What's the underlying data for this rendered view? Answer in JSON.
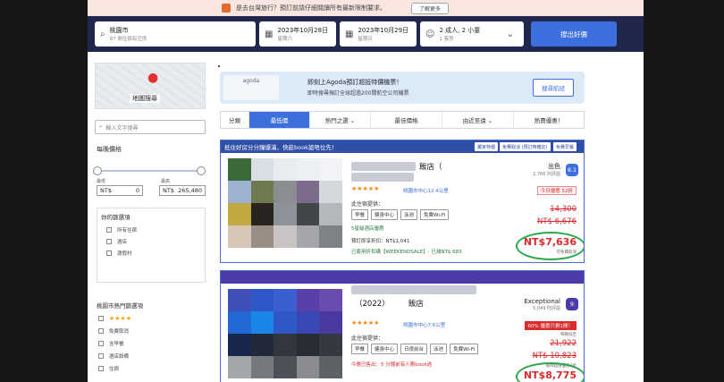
{
  "notice": {
    "text": "是去台灣旅行？預訂前請仔細閱讀所有最新限制要求。",
    "more": "了解更多"
  },
  "search": {
    "destination": "桃園市",
    "destination_sub": "97 間住宿有空房",
    "checkin": "2023年10月28日",
    "checkin_day": "星期六",
    "checkout": "2023年10月29日",
    "checkout_day": "星期日",
    "guests": "2 成人, 2 小童",
    "rooms": "1 客房",
    "button": "搜出好價"
  },
  "sidebar": {
    "map_label": "地圖搜尋",
    "search_placeholder": "輸入文字搜尋",
    "price_title": "每晚價格",
    "min_label": "最低",
    "max_label": "最高",
    "currency": "NT$",
    "min_value": "0",
    "max_value": "265,480",
    "budget_title": "你的篩選項",
    "budget_items": [
      "所有住宿",
      "酒店",
      "渡假村"
    ],
    "popular_title": "桃園市熱門篩選項",
    "popular_items": [
      "★★★★",
      "免費取消",
      "含早餐",
      "酒店設備",
      "住宿"
    ]
  },
  "promo": {
    "logo": "agoda",
    "line1": "即刻上Agoda預訂超抵特價機票！",
    "line2": "即時搜尋預訂全球超過200間航空公司機票",
    "button": "搜尋航班"
  },
  "tabs": [
    "分類",
    "最低價",
    "熱門之選 ⌄",
    "最佳價格",
    "由近至遠 ⌄",
    "熱賣優惠！"
  ],
  "hotels": [
    {
      "header": "抵住好房分分鐘爆滿，快趁book搶唔位先！",
      "tags": [
        "獨家特價",
        "免費取消 (預訂時確定)",
        "免費早餐"
      ],
      "name": "飯店（",
      "stars": "★★★★★",
      "location": "桃園市中心12.4公里",
      "provides": "此住宿提供：",
      "chips": [
        "早餐",
        "健身中心",
        "泳池",
        "免費Wi-Fi"
      ],
      "note1": "5星級酒店優惠",
      "note2": "預訂即享折扣：NT$1,041",
      "note3": "已套用折扣碼【WEEKENDSALE】- 已減NT$ 683",
      "review_word": "出色",
      "review_count": "2,766 則評語",
      "score": "8.1",
      "deal": "今日優惠 52折",
      "old_price_1": "14,300",
      "old_price_2": "NT$ 6,676",
      "price": "NT$7,636",
      "price_sub": "可免費取消"
    },
    {
      "header": "",
      "tags": [],
      "name": "（2022）　　　飯店",
      "stars": "★★★★★",
      "location": "桃園市中心7.6公里",
      "provides": "此住宿提供：",
      "chips": [
        "早餐",
        "健身中心",
        "日夜前台",
        "泳池",
        "免費Wi-Fi"
      ],
      "note1": "今晚已售出：5 分鐘前有人剛book過",
      "review_word": "Exceptional",
      "review_count": "5,049 則評語",
      "score": "9",
      "deal": "60% 優惠只剩1間！",
      "deal_sub": "每晚低至",
      "old_price_1": "21,922",
      "old_price_2": "NT$ 10,823",
      "price_note": "限時超值優惠3折",
      "price": "NT$8,775"
    }
  ],
  "colors": {
    "brand": "#3d6fdd",
    "navy": "#20274d",
    "price": "#d92b2b",
    "highlight": "#2aa84a"
  }
}
